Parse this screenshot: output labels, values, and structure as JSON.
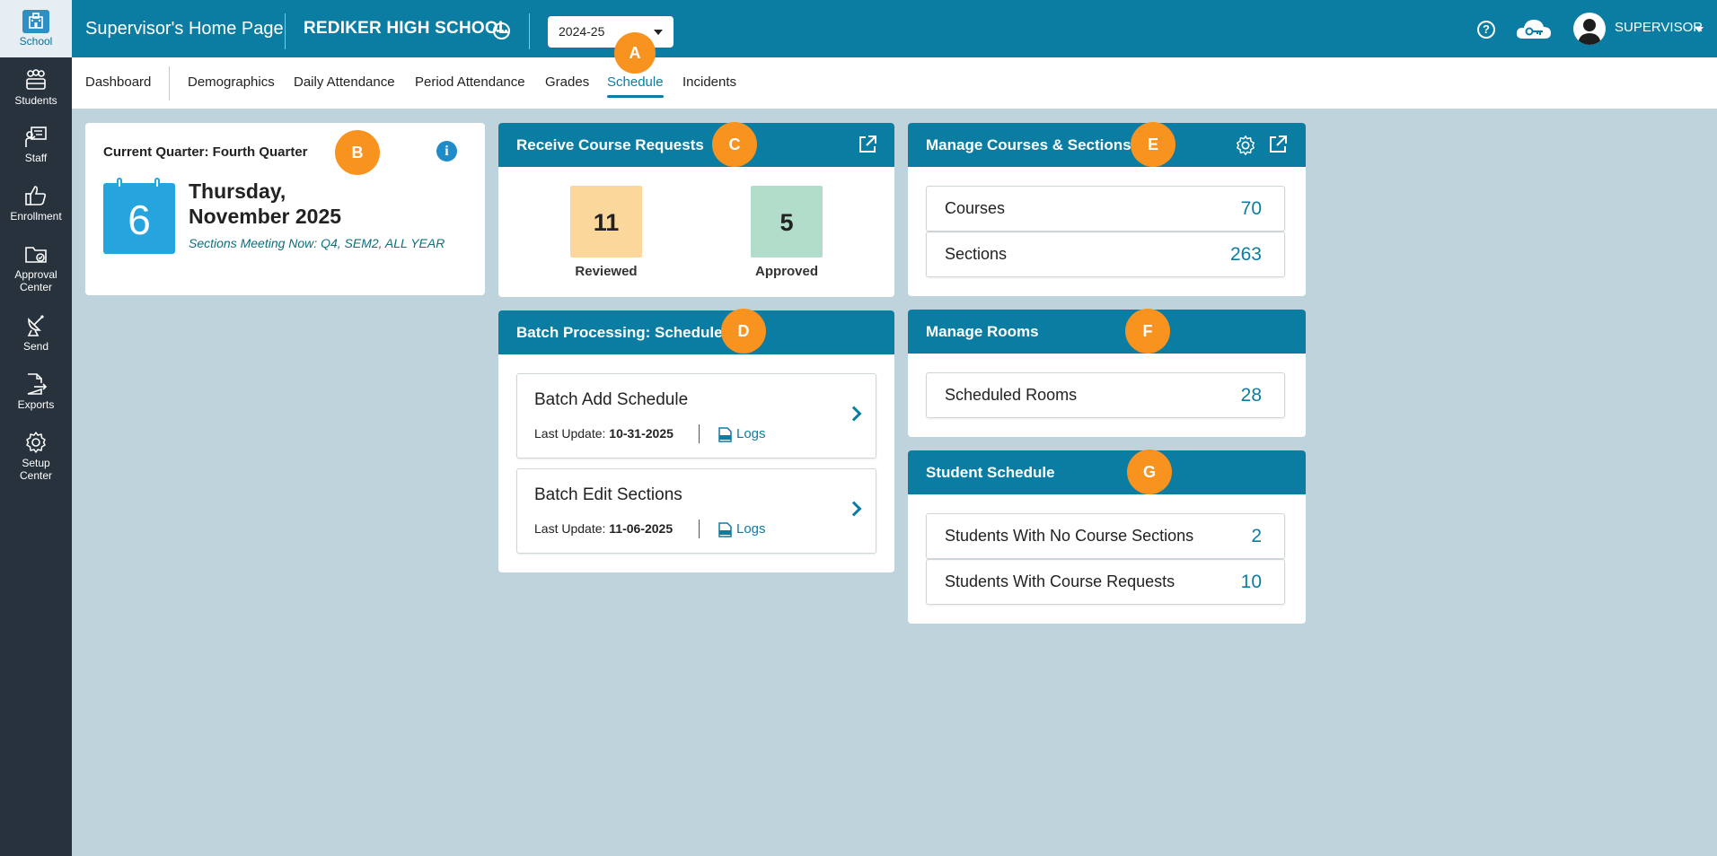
{
  "rail": {
    "items": [
      {
        "label": "School",
        "icon": "school-building-icon"
      },
      {
        "label": "Students",
        "icon": "students-group-icon"
      },
      {
        "label": "Staff",
        "icon": "staff-presenter-icon"
      },
      {
        "label": "Enrollment",
        "icon": "thumbs-up-icon"
      },
      {
        "label": "Approval",
        "label2": "Center",
        "icon": "folder-check-icon"
      },
      {
        "label": "Send",
        "icon": "satellite-dish-icon"
      },
      {
        "label": "Exports",
        "icon": "file-export-icon"
      },
      {
        "label": "Setup",
        "label2": "Center",
        "icon": "gear-icon"
      }
    ]
  },
  "header": {
    "title": "Supervisor's Home Page",
    "school": "REDIKER HIGH SCHOOL",
    "year": "2024-25",
    "user": "SUPERVISOR"
  },
  "tabs": [
    "Dashboard",
    "Demographics",
    "Daily Attendance",
    "Period Attendance",
    "Grades",
    "Schedule",
    "Incidents"
  ],
  "active_tab": "Schedule",
  "markers": {
    "a": "A",
    "b": "B",
    "c": "C",
    "d": "D",
    "e": "E",
    "f": "F",
    "g": "G"
  },
  "quarter_card": {
    "label": "Current Quarter: Fourth Quarter",
    "day": "6",
    "weekday": "Thursday,",
    "month_year": "November 2025",
    "sections_now": "Sections Meeting Now: Q4, SEM2, ALL YEAR"
  },
  "course_requests": {
    "title": "Receive Course Requests",
    "reviewed_value": "11",
    "reviewed_label": "Reviewed",
    "approved_value": "5",
    "approved_label": "Approved"
  },
  "batch": {
    "title": "Batch Processing: Schedule",
    "items": [
      {
        "title": "Batch Add Schedule",
        "update_label": "Last Update:",
        "date": "10-31-2025",
        "logs": "Logs"
      },
      {
        "title": "Batch Edit Sections",
        "update_label": "Last Update:",
        "date": "11-06-2025",
        "logs": "Logs"
      }
    ]
  },
  "courses": {
    "title": "Manage Courses & Sections",
    "rows": [
      {
        "label": "Courses",
        "value": "70"
      },
      {
        "label": "Sections",
        "value": "263"
      }
    ]
  },
  "rooms": {
    "title": "Manage Rooms",
    "rows": [
      {
        "label": "Scheduled Rooms",
        "value": "28"
      }
    ]
  },
  "student_schedule": {
    "title": "Student Schedule",
    "rows": [
      {
        "label": "Students With No Course Sections",
        "value": "2"
      },
      {
        "label": "Students With Course Requests",
        "value": "10"
      }
    ]
  },
  "colors": {
    "primary": "#0b7da3",
    "marker": "#f7931e",
    "reviewed": "#fcd79b",
    "approved": "#b3ddcb",
    "calendar": "#25a4dd"
  }
}
